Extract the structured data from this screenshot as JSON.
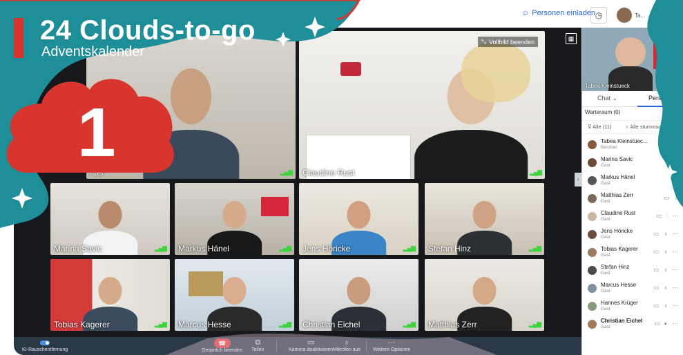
{
  "topbar": {
    "invite_label": "Personen einladen",
    "user_label": "Ta..."
  },
  "stage": {
    "fullscreen_label": "Vollbild beenden",
    "tiles": [
      {
        "name": "...er"
      },
      {
        "name": "Claudine Rust"
      },
      {
        "name": "Marina Savic"
      },
      {
        "name": "Markus Hänel"
      },
      {
        "name": "Jens Höricke"
      },
      {
        "name": "Stefan Hinz"
      },
      {
        "name": "Tobias Kagerer"
      },
      {
        "name": "Marcus Hesse"
      },
      {
        "name": "Christian Eichel"
      },
      {
        "name": "Matthias Zerr"
      }
    ]
  },
  "toolbar": {
    "noise_label": "KI-Rauschentfernung",
    "end_label": "Gespräch beenden",
    "share_label": "Teilen",
    "camera_label": "Kamera deaktivieren",
    "mic_label": "Mikrofon aus",
    "more_label": "Weitere Optionen"
  },
  "panel": {
    "self_name": "Tabea Kleinstueck",
    "tab_chat": "Chat",
    "tab_people": "Personen",
    "waiting_room": "Warteraum (0)",
    "filter_all": "Alle (11)",
    "mute_all": "Alle stummschalten",
    "participants": [
      {
        "name": "Tabea Kleinstuec...",
        "role": "Besitzer"
      },
      {
        "name": "Marina Savic",
        "role": "Gast"
      },
      {
        "name": "Markus Hänel",
        "role": "Gast"
      },
      {
        "name": "Matthias Zerr",
        "role": "Gast"
      },
      {
        "name": "Claudine Rust",
        "role": "Gast"
      },
      {
        "name": "Jens Höricke",
        "role": "Gast"
      },
      {
        "name": "Tobias Kagerer",
        "role": "Gast"
      },
      {
        "name": "Stefan Hinz",
        "role": "Gast"
      },
      {
        "name": "Marcus Hesse",
        "role": "Gast"
      },
      {
        "name": "Hannes Krüger",
        "role": "Gast"
      },
      {
        "name": "Christian Eichel",
        "role": "Gast"
      }
    ]
  },
  "overlay": {
    "title": "24 Clouds-to-go",
    "subtitle": "Adventskalender",
    "day_number": "1"
  },
  "colors": {
    "teal": "#1e8e99",
    "red": "#d8352e",
    "accent_blue": "#2a63d6",
    "toolbar": "#2b3947"
  }
}
